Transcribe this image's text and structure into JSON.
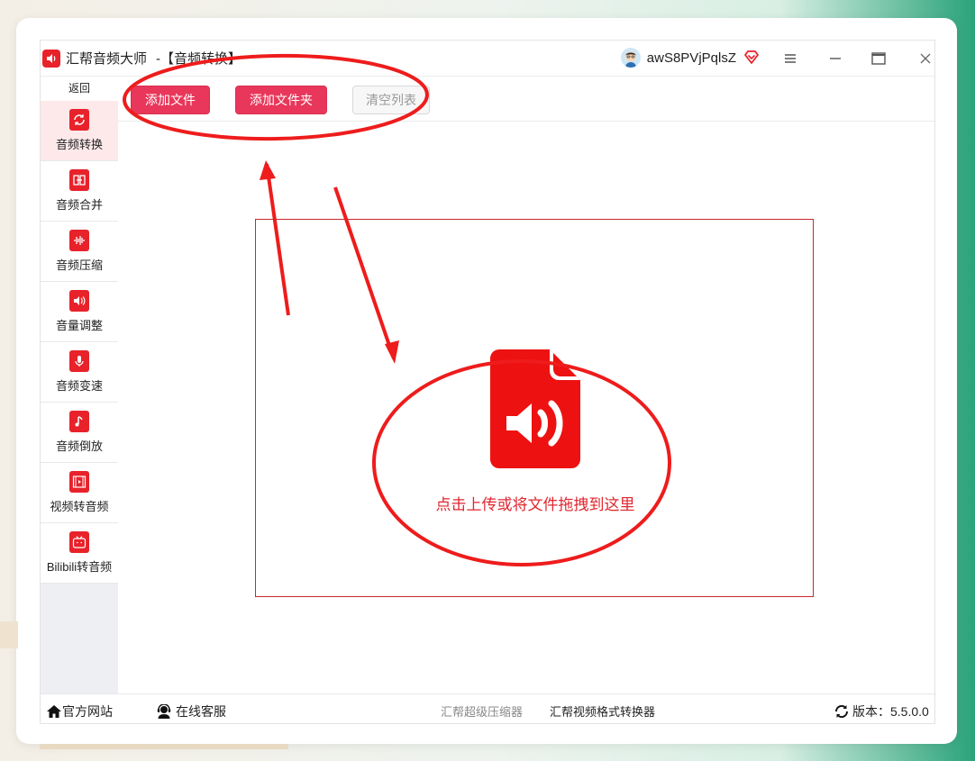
{
  "window": {
    "app_title": "汇帮音频大师",
    "subtitle": "-【音频转换】",
    "username": "awS8PVjPqlsZ"
  },
  "sidebar": {
    "back_label": "返回",
    "items": [
      {
        "label": "音频转换",
        "icon": "audio-convert-icon",
        "active": true
      },
      {
        "label": "音频合并",
        "icon": "audio-merge-icon",
        "active": false
      },
      {
        "label": "音频压缩",
        "icon": "audio-compress-icon",
        "active": false
      },
      {
        "label": "音量调整",
        "icon": "volume-adjust-icon",
        "active": false
      },
      {
        "label": "音频变速",
        "icon": "microphone-icon",
        "active": false
      },
      {
        "label": "音频倒放",
        "icon": "music-note-icon",
        "active": false
      },
      {
        "label": "视频转音频",
        "icon": "film-icon",
        "active": false
      },
      {
        "label": "Bilibili转音频",
        "icon": "tv-icon",
        "active": false
      }
    ]
  },
  "toolbar": {
    "add_file_label": "添加文件",
    "add_folder_label": "添加文件夹",
    "clear_list_label": "清空列表"
  },
  "dropzone": {
    "hint": "点击上传或将文件拖拽到这里",
    "icon": "audio-file-icon"
  },
  "statusbar": {
    "official_site_label": "官方网站",
    "online_service_label": "在线客服",
    "compressor_link": "汇帮超级压缩器",
    "video_converter_link": "汇帮视频格式转换器",
    "version_label": "版本：5.5.0.0"
  },
  "colors": {
    "accent": "#e8222a",
    "button_red": "#e8375a",
    "annotation_red": "#ee1c1c"
  }
}
